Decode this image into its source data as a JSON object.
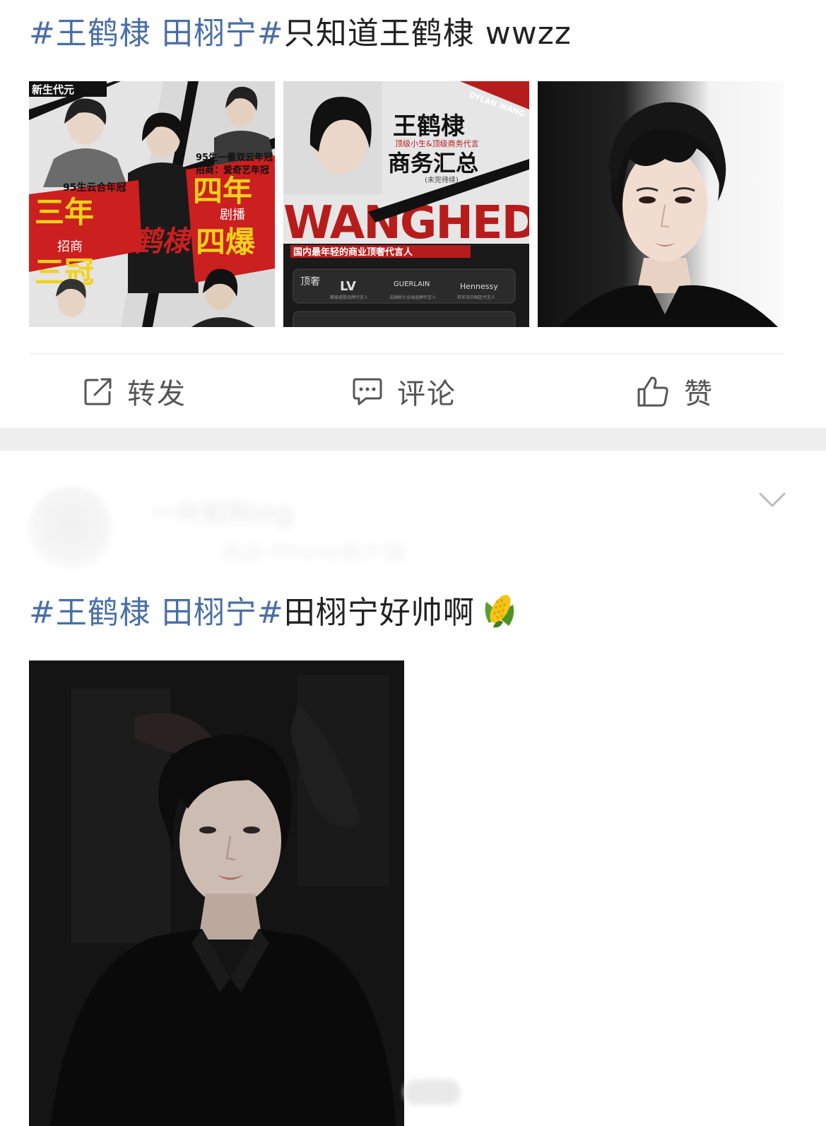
{
  "posts": [
    {
      "hashtag": "#王鹤棣 田栩宁#",
      "text": "只知道王鹤棣 wwzz",
      "images": [
        {
          "name": "wang-hedi-poster-collage",
          "caption_main": "王鹤棣",
          "lines": [
            "新生代元",
            "95生云合年冠",
            "95生一番双云年冠",
            "招商：爱奇艺年冠",
            "三年",
            "招商",
            "三冠",
            "四年",
            "剧播",
            "四爆"
          ]
        },
        {
          "name": "wang-hedi-business-summary",
          "title": "王鹤棣",
          "subtitle": "商务汇总",
          "tagline": "顶级小生&顶级商务代言",
          "note": "(未完待续)",
          "banner": "国内最年轻的商业顶奢代言人",
          "brand_label": "顶奢",
          "brands": [
            "LV",
            "GUERLAIN",
            "Hennessy"
          ],
          "brand_notes": [
            "路易威登品牌代言人",
            "法国娇兰全球品牌代言人",
            "轩尼诗中国区代言人"
          ],
          "ribbon": "DYLAN WANG",
          "big_letters": "WANGHEDI"
        },
        {
          "name": "wang-hedi-portrait"
        }
      ]
    },
    {
      "user": {
        "name": "一叶知秋ing",
        "meta": "来自 iPhone客户端"
      },
      "hashtag": "#王鹤棣 田栩宁#",
      "text": "田栩宁好帅啊",
      "emoji": "corn-emoji",
      "images": [
        {
          "name": "tian-xuning-portrait"
        }
      ]
    }
  ],
  "actions": {
    "repost": "转发",
    "comment": "评论",
    "like": "赞"
  },
  "colors": {
    "hashtag": "#4a6fa5",
    "text": "#222222",
    "action_text": "#555555",
    "separator": "#eeeeee",
    "divider": "#e6e6e6"
  }
}
